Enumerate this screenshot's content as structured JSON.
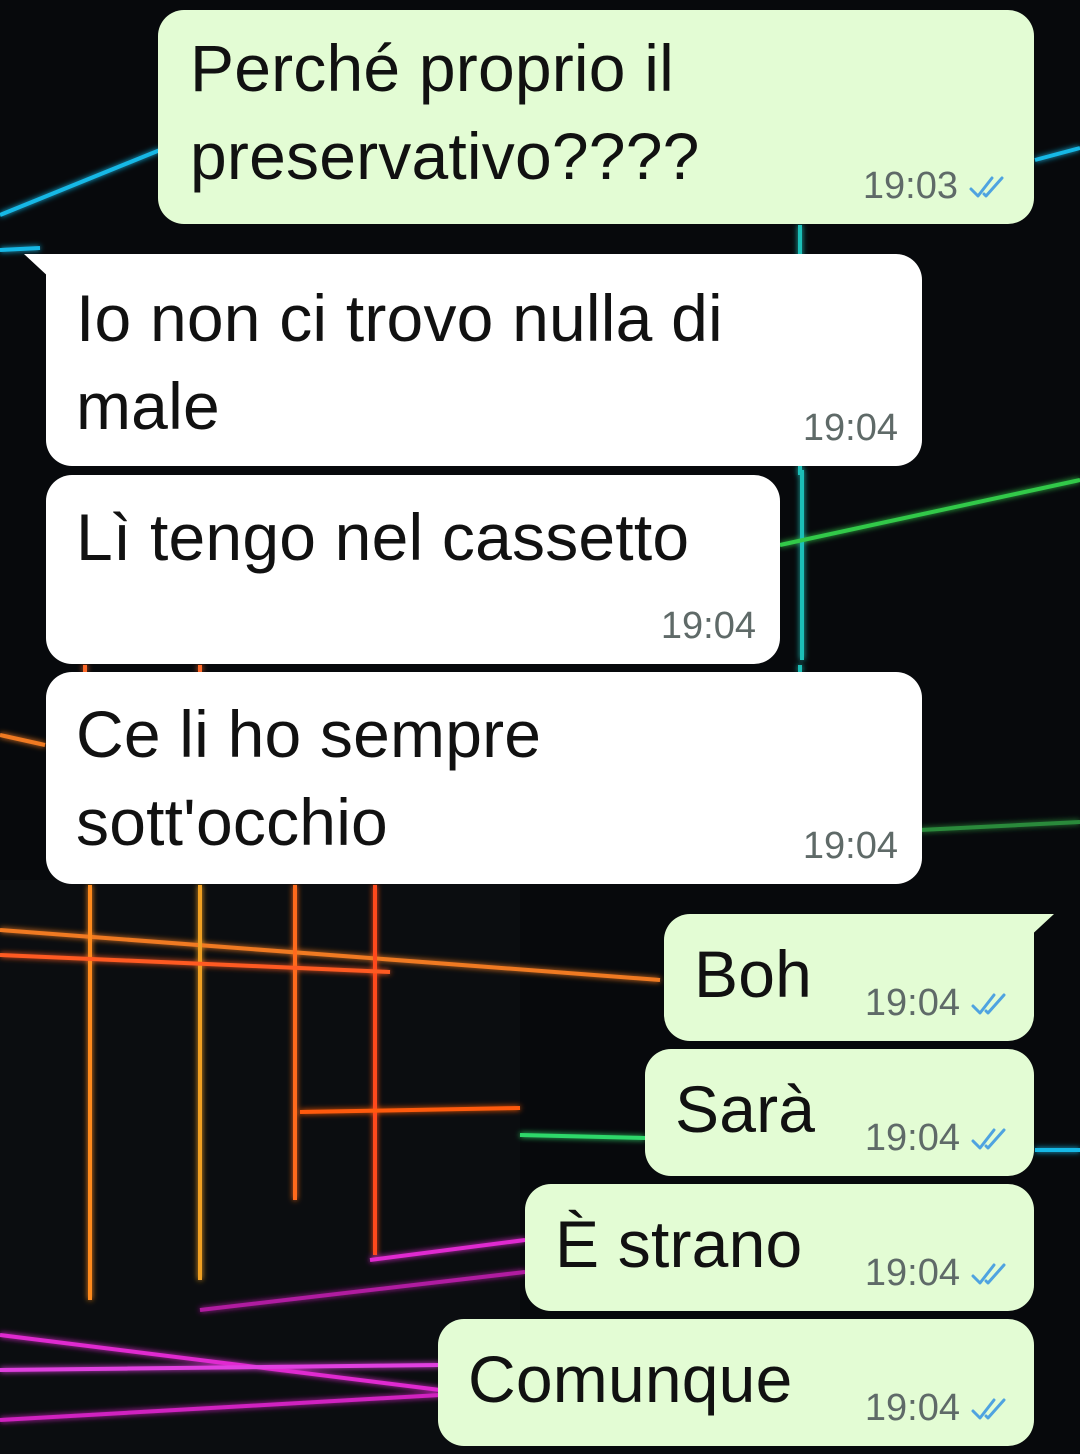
{
  "chat": {
    "messages": [
      {
        "direction": "out",
        "text": "Perché proprio il\npreservativo????",
        "time": "19:03",
        "status": "read"
      },
      {
        "direction": "in",
        "text": "Io non ci trovo nulla di\nmale",
        "time": "19:04"
      },
      {
        "direction": "in",
        "text": "Lì tengo nel cassetto",
        "time": "19:04"
      },
      {
        "direction": "in",
        "text": "Ce li ho sempre\nsott'occhio",
        "time": "19:04"
      },
      {
        "direction": "out",
        "text": "Boh",
        "time": "19:04",
        "status": "read"
      },
      {
        "direction": "out",
        "text": "Sarà",
        "time": "19:04",
        "status": "read"
      },
      {
        "direction": "out",
        "text": "È strano",
        "time": "19:04",
        "status": "read"
      },
      {
        "direction": "out",
        "text": "Comunque",
        "time": "19:04",
        "status": "read"
      }
    ]
  },
  "colors": {
    "incoming_bubble": "#ffffff",
    "outgoing_bubble": "#e3fcd4",
    "read_ticks": "#4fa3e0",
    "wallpaper": "#07090c"
  },
  "icons": {
    "read_status": "double-check-icon"
  }
}
